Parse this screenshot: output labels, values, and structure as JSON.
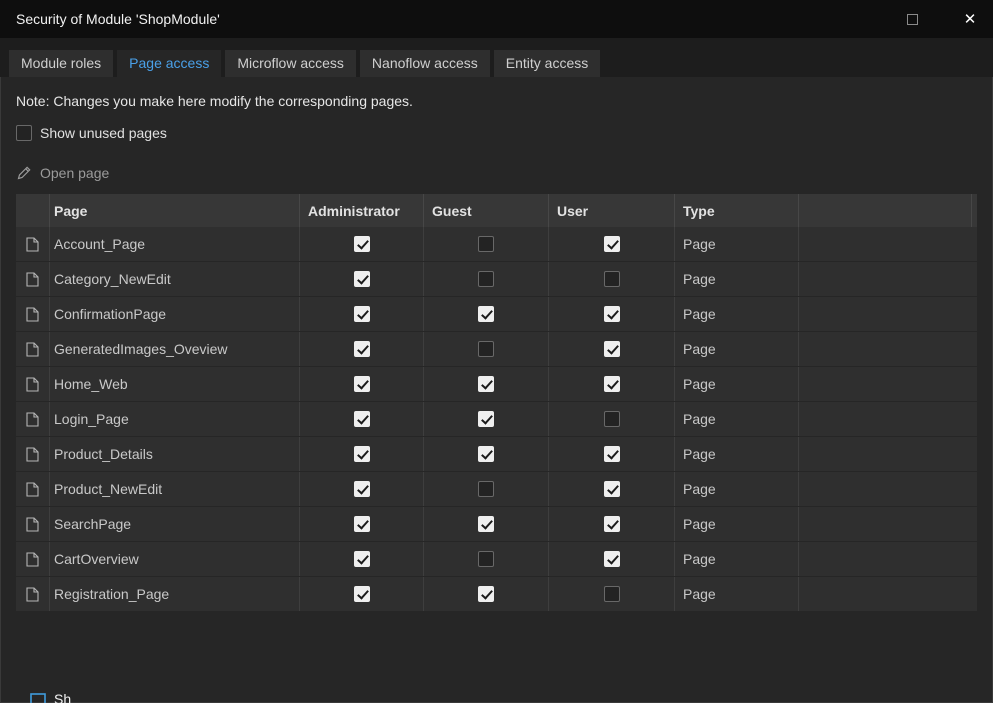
{
  "colors": {
    "accent": "#4aa0e8",
    "titlebar_bg": "#0e0e0e",
    "content_bg": "#262626",
    "checkbox_checked_bg": "#efefef",
    "checkbox_check": "#1a1a1a"
  },
  "window": {
    "title": "Security of Module 'ShopModule'"
  },
  "tabs": [
    {
      "label": "Module roles",
      "active": false
    },
    {
      "label": "Page access",
      "active": true
    },
    {
      "label": "Microflow access",
      "active": false
    },
    {
      "label": "Nanoflow access",
      "active": false
    },
    {
      "label": "Entity access",
      "active": false
    }
  ],
  "note": "Note: Changes you make here modify the corresponding pages.",
  "show_unused_pages": {
    "label": "Show unused pages",
    "checked": false
  },
  "toolbar": {
    "open_page_label": "Open page"
  },
  "table": {
    "columns": [
      "Page",
      "Administrator",
      "Guest",
      "User",
      "Type"
    ],
    "rows": [
      {
        "page": "Account_Page",
        "administrator": true,
        "guest": false,
        "user": true,
        "type": "Page"
      },
      {
        "page": "Category_NewEdit",
        "administrator": true,
        "guest": false,
        "user": false,
        "type": "Page"
      },
      {
        "page": "ConfirmationPage",
        "administrator": true,
        "guest": true,
        "user": true,
        "type": "Page"
      },
      {
        "page": "GeneratedImages_Oveview",
        "administrator": true,
        "guest": false,
        "user": true,
        "type": "Page"
      },
      {
        "page": "Home_Web",
        "administrator": true,
        "guest": true,
        "user": true,
        "type": "Page"
      },
      {
        "page": "Login_Page",
        "administrator": true,
        "guest": true,
        "user": false,
        "type": "Page"
      },
      {
        "page": "Product_Details",
        "administrator": true,
        "guest": true,
        "user": true,
        "type": "Page"
      },
      {
        "page": "Product_NewEdit",
        "administrator": true,
        "guest": false,
        "user": true,
        "type": "Page"
      },
      {
        "page": "SearchPage",
        "administrator": true,
        "guest": true,
        "user": true,
        "type": "Page"
      },
      {
        "page": "CartOverview",
        "administrator": true,
        "guest": false,
        "user": true,
        "type": "Page"
      },
      {
        "page": "Registration_Page",
        "administrator": true,
        "guest": true,
        "user": false,
        "type": "Page"
      }
    ]
  },
  "footer": {
    "partial_label": "Sh"
  }
}
